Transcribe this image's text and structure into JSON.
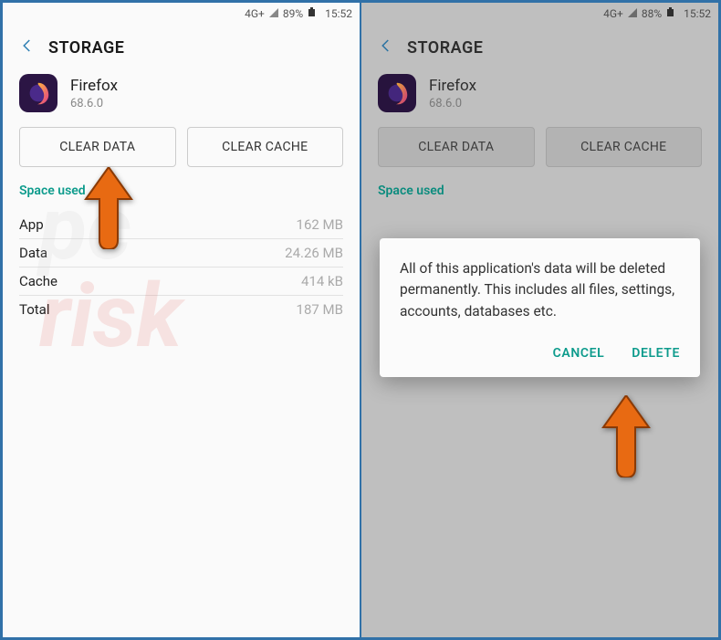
{
  "left": {
    "status": {
      "network": "4G+",
      "battery_pct": "89%",
      "time": "15:52"
    },
    "header": {
      "title": "STORAGE"
    },
    "app": {
      "name": "Firefox",
      "version": "68.6.0"
    },
    "buttons": {
      "clear_data": "CLEAR DATA",
      "clear_cache": "CLEAR CACHE"
    },
    "section_label": "Space used",
    "stats": {
      "app": {
        "label": "App",
        "value": "162 MB"
      },
      "data": {
        "label": "Data",
        "value": "24.26 MB"
      },
      "cache": {
        "label": "Cache",
        "value": "414 kB"
      },
      "total": {
        "label": "Total",
        "value": "187 MB"
      }
    }
  },
  "right": {
    "status": {
      "network": "4G+",
      "battery_pct": "88%",
      "time": "15:52"
    },
    "header": {
      "title": "STORAGE"
    },
    "app": {
      "name": "Firefox",
      "version": "68.6.0"
    },
    "buttons": {
      "clear_data": "CLEAR DATA",
      "clear_cache": "CLEAR CACHE"
    },
    "section_label": "Space used",
    "dialog": {
      "message": "All of this application's data will be deleted permanently. This includes all files, settings, accounts, databases etc.",
      "cancel": "CANCEL",
      "delete": "DELETE"
    }
  }
}
